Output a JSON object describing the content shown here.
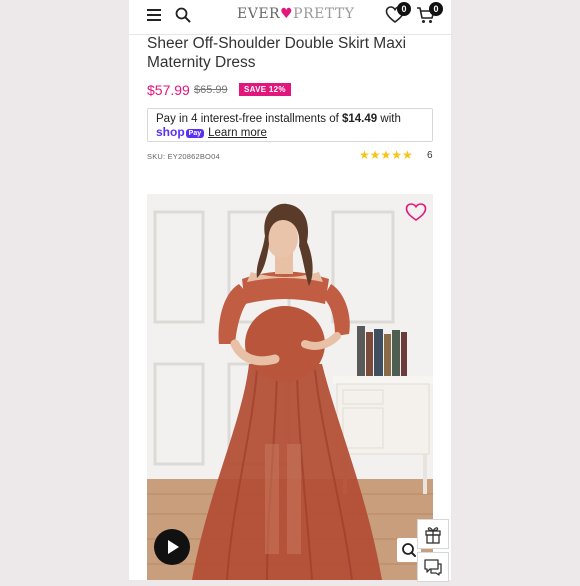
{
  "header": {
    "logo_part1": "EVER",
    "logo_heart": "♥",
    "logo_part2": "PRETTY",
    "wishlist_count": "0",
    "cart_count": "0"
  },
  "product": {
    "title": "Sheer Off-Shoulder Double Skirt Maxi Maternity Dress",
    "price": "$57.99",
    "compare_price": "$65.99",
    "save_badge": "SAVE 12%",
    "sku": "SKU: EY20862BO04",
    "stars": "★★★★★",
    "rating": 5,
    "review_count": "6"
  },
  "installments": {
    "text_prefix": "Pay in 4 interest-free installments of ",
    "amount": "$14.49",
    "text_suffix": " with",
    "brand": "shop",
    "brand_chip": "Pay",
    "learn_more": "Learn more"
  },
  "colors": {
    "brand_pink": "#e2177d",
    "shop_pay_purple": "#5a31f4",
    "star_yellow": "#f5c518",
    "dress_rust": "#b34f36"
  },
  "icons": [
    "hamburger-menu-icon",
    "search-icon",
    "heart-icon",
    "cart-icon",
    "play-icon",
    "zoom-icon",
    "gift-icon",
    "chat-icon"
  ]
}
